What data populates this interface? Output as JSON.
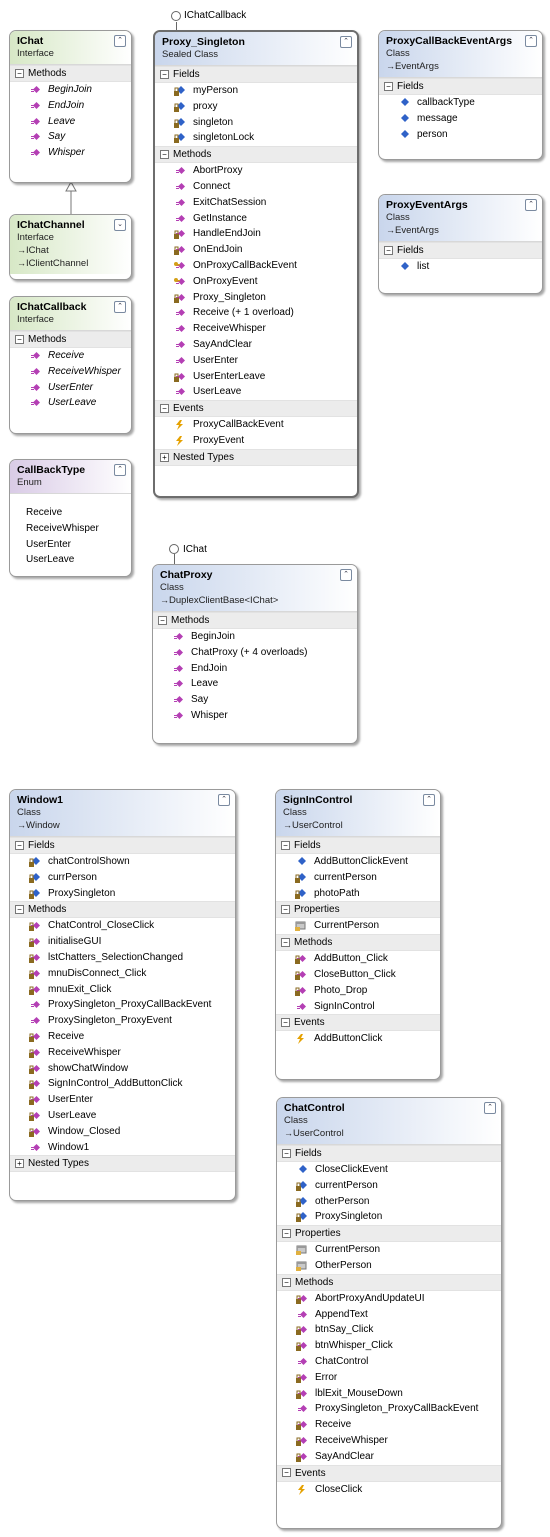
{
  "colors": {
    "interface_header": "#d7e8c6",
    "class_header": "#c9d6ec",
    "enum_header": "#d9cbe6",
    "method_icon": "#b43fb4",
    "field_icon": "#2f62c8",
    "event_icon": "#e5a100",
    "property_icon": "#7a7a7a"
  },
  "boxes": {
    "ichat": {
      "title": "IChat",
      "stereo": "Interface",
      "sections": [
        {
          "label": "Methods",
          "items": [
            {
              "name": "BeginJoin",
              "icon": "interface-method-icon"
            },
            {
              "name": "EndJoin",
              "icon": "interface-method-icon"
            },
            {
              "name": "Leave",
              "icon": "interface-method-icon"
            },
            {
              "name": "Say",
              "icon": "interface-method-icon"
            },
            {
              "name": "Whisper",
              "icon": "interface-method-icon"
            }
          ]
        }
      ]
    },
    "ichatchannel": {
      "title": "IChatChannel",
      "stereo": "Interface",
      "bases": [
        "IChat",
        "IClientChannel"
      ]
    },
    "ichatcallback": {
      "title": "IChatCallback",
      "stereo": "Interface",
      "sections": [
        {
          "label": "Methods",
          "items": [
            {
              "name": "Receive",
              "icon": "interface-method-icon"
            },
            {
              "name": "ReceiveWhisper",
              "icon": "interface-method-icon"
            },
            {
              "name": "UserEnter",
              "icon": "interface-method-icon"
            },
            {
              "name": "UserLeave",
              "icon": "interface-method-icon"
            }
          ]
        }
      ]
    },
    "callbacktype": {
      "title": "CallBackType",
      "stereo": "Enum",
      "values": [
        "Receive",
        "ReceiveWhisper",
        "UserEnter",
        "UserLeave"
      ]
    },
    "proxysingleton": {
      "title": "Proxy_Singleton",
      "stereo": "Sealed Class",
      "lollipop": "IChatCallback",
      "sections": [
        {
          "label": "Fields",
          "items": [
            {
              "name": "myPerson",
              "icon": "private-field-icon"
            },
            {
              "name": "proxy",
              "icon": "private-field-icon"
            },
            {
              "name": "singleton",
              "icon": "private-field-icon"
            },
            {
              "name": "singletonLock",
              "icon": "private-field-icon"
            }
          ]
        },
        {
          "label": "Methods",
          "items": [
            {
              "name": "AbortProxy",
              "icon": "method-icon"
            },
            {
              "name": "Connect",
              "icon": "method-icon"
            },
            {
              "name": "ExitChatSession",
              "icon": "method-icon"
            },
            {
              "name": "GetInstance",
              "icon": "method-icon"
            },
            {
              "name": "HandleEndJoin",
              "icon": "private-method-icon"
            },
            {
              "name": "OnEndJoin",
              "icon": "private-method-icon"
            },
            {
              "name": "OnProxyCallBackEvent",
              "icon": "protected-method-icon"
            },
            {
              "name": "OnProxyEvent",
              "icon": "protected-method-icon"
            },
            {
              "name": "Proxy_Singleton",
              "icon": "private-method-icon"
            },
            {
              "name": "Receive (+ 1 overload)",
              "icon": "method-icon"
            },
            {
              "name": "ReceiveWhisper",
              "icon": "method-icon"
            },
            {
              "name": "SayAndClear",
              "icon": "method-icon"
            },
            {
              "name": "UserEnter",
              "icon": "method-icon"
            },
            {
              "name": "UserEnterLeave",
              "icon": "private-method-icon"
            },
            {
              "name": "UserLeave",
              "icon": "method-icon"
            }
          ]
        },
        {
          "label": "Events",
          "items": [
            {
              "name": "ProxyCallBackEvent",
              "icon": "event-icon"
            },
            {
              "name": "ProxyEvent",
              "icon": "event-icon"
            }
          ]
        }
      ],
      "collapsed": "Nested Types"
    },
    "proxycallbackeventargs": {
      "title": "ProxyCallBackEventArgs",
      "stereo": "Class",
      "base": "EventArgs",
      "sections": [
        {
          "label": "Fields",
          "items": [
            {
              "name": "callbackType",
              "icon": "field-icon"
            },
            {
              "name": "message",
              "icon": "field-icon"
            },
            {
              "name": "person",
              "icon": "field-icon"
            }
          ]
        }
      ]
    },
    "proxyeventargs": {
      "title": "ProxyEventArgs",
      "stereo": "Class",
      "base": "EventArgs",
      "sections": [
        {
          "label": "Fields",
          "items": [
            {
              "name": "list",
              "icon": "field-icon"
            }
          ]
        }
      ]
    },
    "chatproxy": {
      "title": "ChatProxy",
      "stereo": "Class",
      "base": "DuplexClientBase<IChat>",
      "lollipop": "IChat",
      "sections": [
        {
          "label": "Methods",
          "items": [
            {
              "name": "BeginJoin",
              "icon": "method-icon"
            },
            {
              "name": "ChatProxy (+ 4 overloads)",
              "icon": "method-icon"
            },
            {
              "name": "EndJoin",
              "icon": "method-icon"
            },
            {
              "name": "Leave",
              "icon": "method-icon"
            },
            {
              "name": "Say",
              "icon": "method-icon"
            },
            {
              "name": "Whisper",
              "icon": "method-icon"
            }
          ]
        }
      ]
    },
    "window1": {
      "title": "Window1",
      "stereo": "Class",
      "base": "Window",
      "sections": [
        {
          "label": "Fields",
          "items": [
            {
              "name": "chatControlShown",
              "icon": "private-field-icon"
            },
            {
              "name": "currPerson",
              "icon": "private-field-icon"
            },
            {
              "name": "ProxySingleton",
              "icon": "private-field-icon"
            }
          ]
        },
        {
          "label": "Methods",
          "items": [
            {
              "name": "ChatControl_CloseClick",
              "icon": "private-method-icon"
            },
            {
              "name": "initialiseGUI",
              "icon": "private-method-icon"
            },
            {
              "name": "lstChatters_SelectionChanged",
              "icon": "private-method-icon"
            },
            {
              "name": "mnuDisConnect_Click",
              "icon": "private-method-icon"
            },
            {
              "name": "mnuExit_Click",
              "icon": "private-method-icon"
            },
            {
              "name": "ProxySingleton_ProxyCallBackEvent",
              "icon": "method-icon"
            },
            {
              "name": "ProxySingleton_ProxyEvent",
              "icon": "method-icon"
            },
            {
              "name": "Receive",
              "icon": "private-method-icon"
            },
            {
              "name": "ReceiveWhisper",
              "icon": "private-method-icon"
            },
            {
              "name": "showChatWindow",
              "icon": "private-method-icon"
            },
            {
              "name": "SignInControl_AddButtonClick",
              "icon": "private-method-icon"
            },
            {
              "name": "UserEnter",
              "icon": "private-method-icon"
            },
            {
              "name": "UserLeave",
              "icon": "private-method-icon"
            },
            {
              "name": "Window_Closed",
              "icon": "private-method-icon"
            },
            {
              "name": "Window1",
              "icon": "method-icon"
            }
          ]
        }
      ],
      "collapsed": "Nested Types"
    },
    "signincontrol": {
      "title": "SignInControl",
      "stereo": "Class",
      "base": "UserControl",
      "sections": [
        {
          "label": "Fields",
          "items": [
            {
              "name": "AddButtonClickEvent",
              "icon": "field-icon"
            },
            {
              "name": "currentPerson",
              "icon": "private-field-icon"
            },
            {
              "name": "photoPath",
              "icon": "private-field-icon"
            }
          ]
        },
        {
          "label": "Properties",
          "items": [
            {
              "name": "CurrentPerson",
              "icon": "property-icon"
            }
          ]
        },
        {
          "label": "Methods",
          "items": [
            {
              "name": "AddButton_Click",
              "icon": "private-method-icon"
            },
            {
              "name": "CloseButton_Click",
              "icon": "private-method-icon"
            },
            {
              "name": "Photo_Drop",
              "icon": "private-method-icon"
            },
            {
              "name": "SignInControl",
              "icon": "method-icon"
            }
          ]
        },
        {
          "label": "Events",
          "items": [
            {
              "name": "AddButtonClick",
              "icon": "event-icon"
            }
          ]
        }
      ]
    },
    "chatcontrol": {
      "title": "ChatControl",
      "stereo": "Class",
      "base": "UserControl",
      "sections": [
        {
          "label": "Fields",
          "items": [
            {
              "name": "CloseClickEvent",
              "icon": "field-icon"
            },
            {
              "name": "currentPerson",
              "icon": "private-field-icon"
            },
            {
              "name": "otherPerson",
              "icon": "private-field-icon"
            },
            {
              "name": "ProxySingleton",
              "icon": "private-field-icon"
            }
          ]
        },
        {
          "label": "Properties",
          "items": [
            {
              "name": "CurrentPerson",
              "icon": "property-icon"
            },
            {
              "name": "OtherPerson",
              "icon": "property-icon"
            }
          ]
        },
        {
          "label": "Methods",
          "items": [
            {
              "name": "AbortProxyAndUpdateUI",
              "icon": "private-method-icon"
            },
            {
              "name": "AppendText",
              "icon": "method-icon"
            },
            {
              "name": "btnSay_Click",
              "icon": "private-method-icon"
            },
            {
              "name": "btnWhisper_Click",
              "icon": "private-method-icon"
            },
            {
              "name": "ChatControl",
              "icon": "method-icon"
            },
            {
              "name": "Error",
              "icon": "private-method-icon"
            },
            {
              "name": "lblExit_MouseDown",
              "icon": "private-method-icon"
            },
            {
              "name": "ProxySingleton_ProxyCallBackEvent",
              "icon": "method-icon"
            },
            {
              "name": "Receive",
              "icon": "private-method-icon"
            },
            {
              "name": "ReceiveWhisper",
              "icon": "private-method-icon"
            },
            {
              "name": "SayAndClear",
              "icon": "private-method-icon"
            }
          ]
        },
        {
          "label": "Events",
          "items": [
            {
              "name": "CloseClick",
              "icon": "event-icon"
            }
          ]
        }
      ]
    }
  }
}
